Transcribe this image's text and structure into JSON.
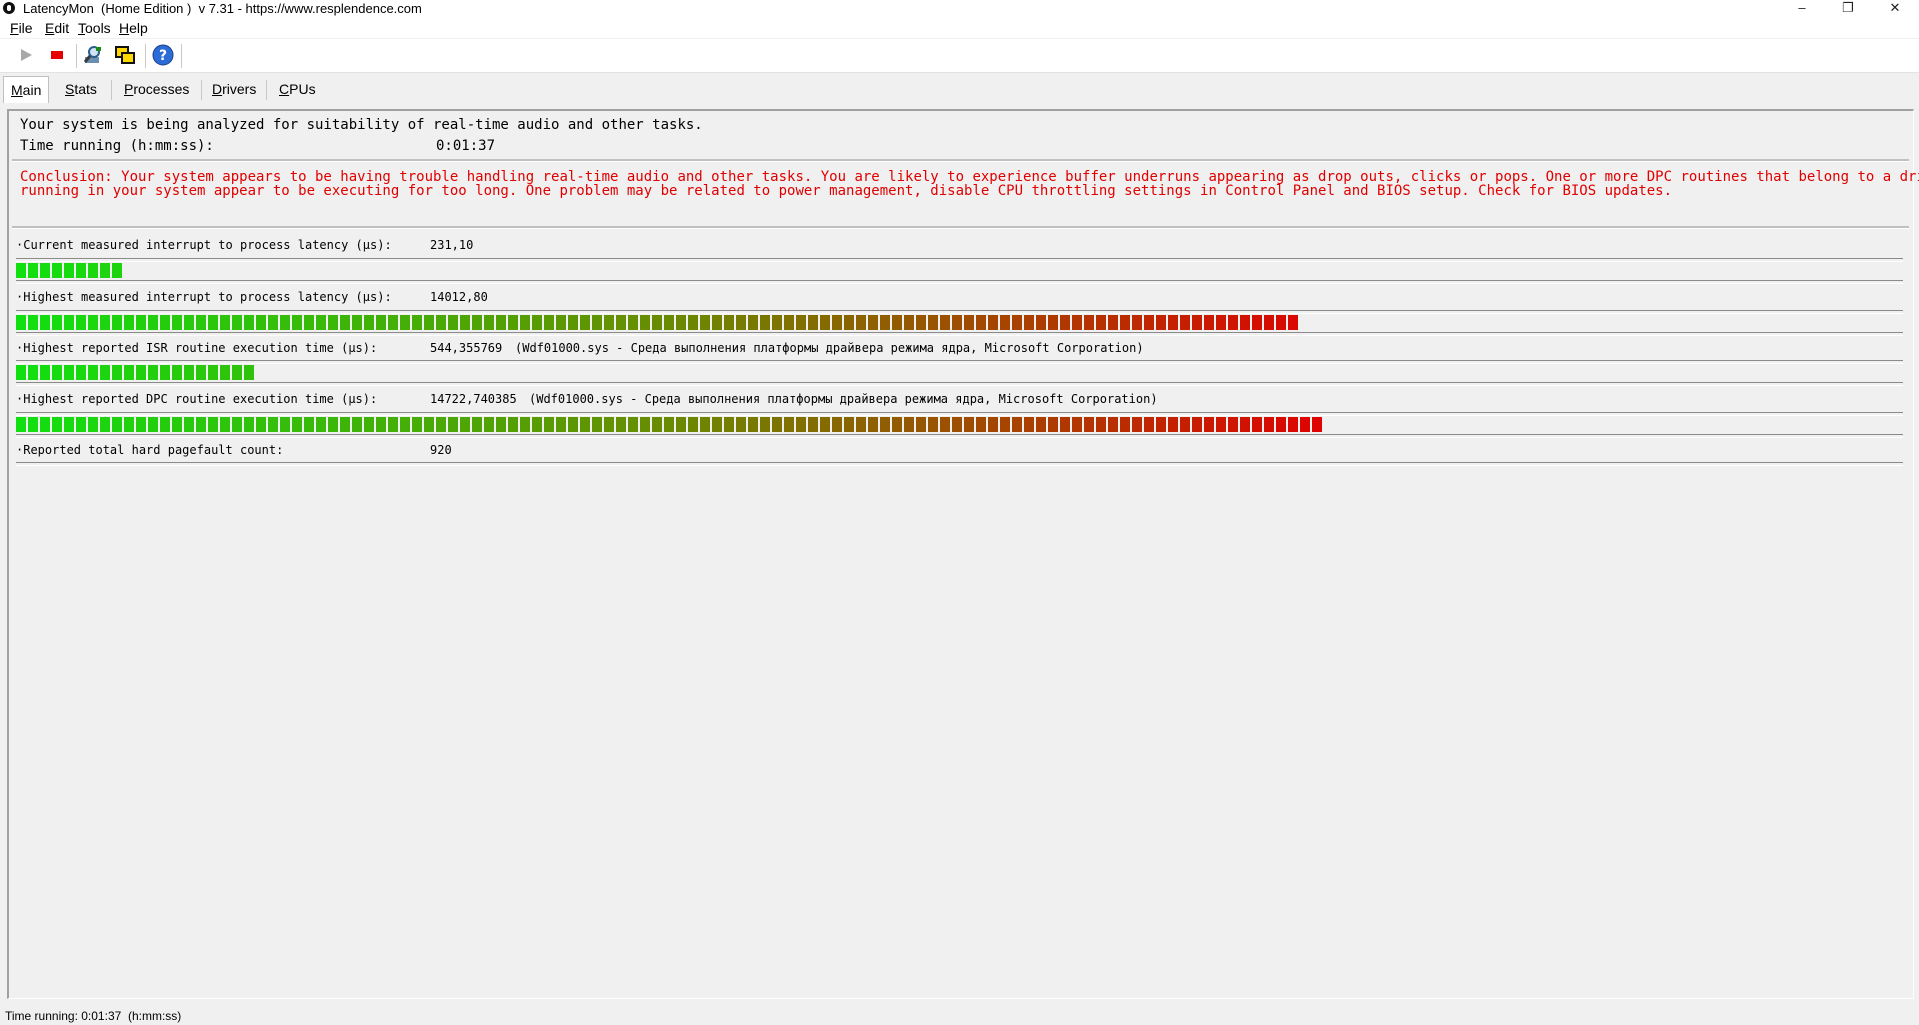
{
  "window": {
    "title": "LatencyMon  (Home Edition )  v 7.31 - https://www.resplendence.com",
    "minimize": "–",
    "maximize": "❐",
    "close": "✕"
  },
  "menu": [
    {
      "accel": "F",
      "rest": "ile"
    },
    {
      "accel": "E",
      "rest": "dit"
    },
    {
      "accel": "T",
      "rest": "ools"
    },
    {
      "accel": "H",
      "rest": "elp"
    }
  ],
  "toolbar": {
    "buttons": [
      "play-icon",
      "stop-icon",
      "search-drivers-icon",
      "windows-icon",
      "help-icon"
    ]
  },
  "tabs": [
    {
      "accel": "M",
      "rest": "ain",
      "active": true
    },
    {
      "accel": "S",
      "rest": "tats",
      "active": false
    },
    {
      "accel": "P",
      "rest": "rocesses",
      "active": false
    },
    {
      "accel": "D",
      "rest": "rivers",
      "active": false
    },
    {
      "accel": "C",
      "rest": "PUs",
      "active": false
    }
  ],
  "main": {
    "analysis_text": "Your system is being analyzed for suitability of real-time audio and other tasks.",
    "time_label": "Time running (h:mm:ss):",
    "time_value": "0:01:37",
    "conclusion": "Conclusion: Your system appears to be having trouble handling real-time audio and other tasks. You are likely to experience buffer underruns appearing as drop outs, clicks or pops. One or more DPC routines that belong to a driver\nrunning in your system appear to be executing for too long. One problem may be related to power management, disable CPU throttling settings in Control Panel and BIOS setup. Check for BIOS updates."
  },
  "metrics": [
    {
      "label": "·Current measured interrupt to process latency (µs):",
      "value": "231,10",
      "driver": "",
      "bar_segments": 9
    },
    {
      "label": "·Highest measured interrupt to process latency (µs):",
      "value": "14012,80",
      "driver": "",
      "bar_segments": 107
    },
    {
      "label": "·Highest reported ISR routine execution time (µs):",
      "value": "544,355769",
      "driver": "(Wdf01000.sys - Среда выполнения платформы драйвера режима ядра, Microsoft Corporation)",
      "bar_segments": 20
    },
    {
      "label": "·Highest reported DPC routine execution time (µs):",
      "value": "14722,740385",
      "driver": "(Wdf01000.sys - Среда выполнения платформы драйвера режима ядра, Microsoft Corporation)",
      "bar_segments": 109
    },
    {
      "label": "·Reported total hard pagefault count:",
      "value": "920",
      "driver": "",
      "bar_segments": 0
    }
  ],
  "colors": {
    "bar_start": "#10e010",
    "bar_mid": "#6a8a00",
    "bar_end": "#e00000",
    "conclusion": "#e00000"
  },
  "statusbar": {
    "text": "Time running: 0:01:37  (h:mm:ss)"
  }
}
